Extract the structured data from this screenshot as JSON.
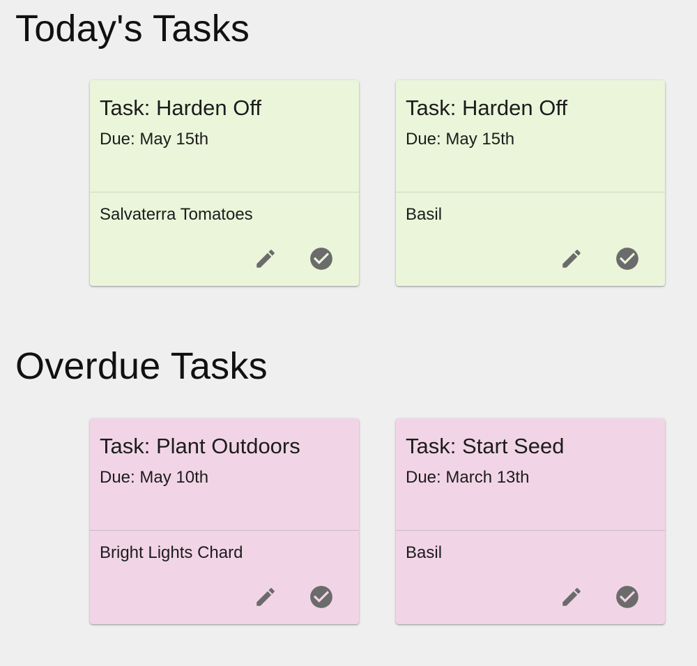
{
  "sections": {
    "today": {
      "title": "Today's Tasks",
      "cards": [
        {
          "task": "Task: Harden Off",
          "due": "Due: May 15th",
          "plant": "Salvaterra Tomatoes",
          "edit_icon": "pencil-icon",
          "complete_icon": "check-circle-icon"
        },
        {
          "task": "Task: Harden Off",
          "due": "Due: May 15th",
          "plant": "Basil",
          "edit_icon": "pencil-icon",
          "complete_icon": "check-circle-icon"
        }
      ]
    },
    "overdue": {
      "title": "Overdue Tasks",
      "cards": [
        {
          "task": "Task: Plant Outdoors",
          "due": "Due: May 10th",
          "plant": "Bright Lights Chard",
          "edit_icon": "pencil-icon",
          "complete_icon": "check-circle-icon"
        },
        {
          "task": "Task: Start Seed",
          "due": "Due: March 13th",
          "plant": "Basil",
          "edit_icon": "pencil-icon",
          "complete_icon": "check-circle-icon"
        }
      ]
    }
  },
  "colors": {
    "background": "#efefef",
    "today_card": "#eaf5da",
    "overdue_card": "#f1d5e6",
    "icon": "#6b6b6b"
  }
}
